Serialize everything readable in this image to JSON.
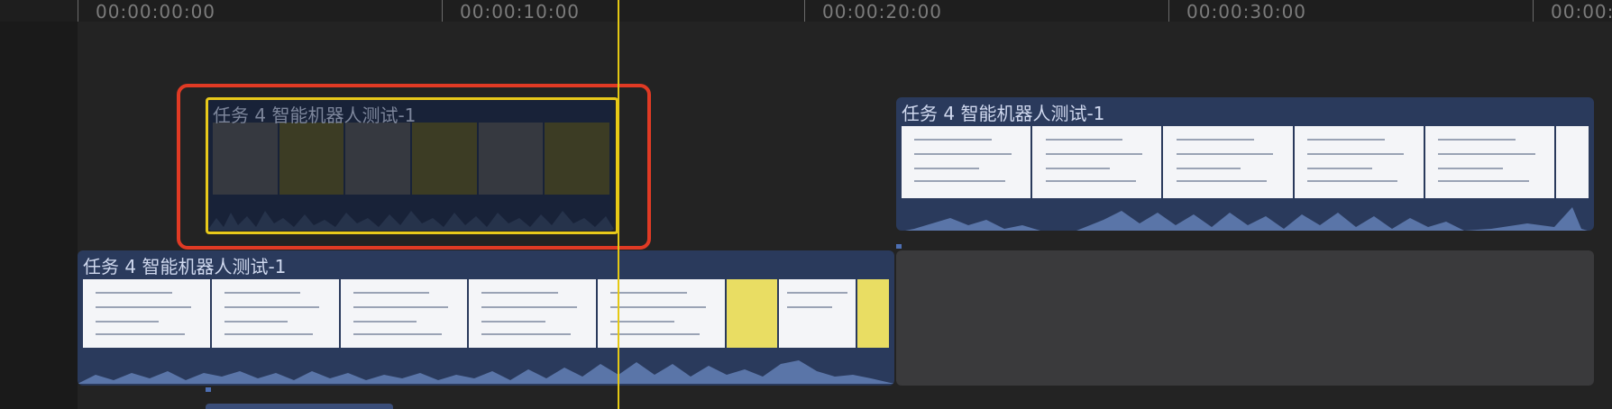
{
  "ruler": {
    "ticks": [
      "00:00:00:00",
      "00:00:10:00",
      "00:00:20:00",
      "00:00:30:00",
      "00:00:"
    ]
  },
  "clips": {
    "connected_clip_1": {
      "title": "任务 4 智能机器人测试-1"
    },
    "connected_clip_2": {
      "title": "任务 4 智能机器人测试-1"
    },
    "primary_clip": {
      "title": "任务 4 智能机器人测试-1"
    }
  },
  "colors": {
    "clip_blue": "#2a3a5c",
    "playhead": "#e4c814",
    "selection_red": "#e03a24",
    "selection_yellow": "#e8c91a"
  }
}
